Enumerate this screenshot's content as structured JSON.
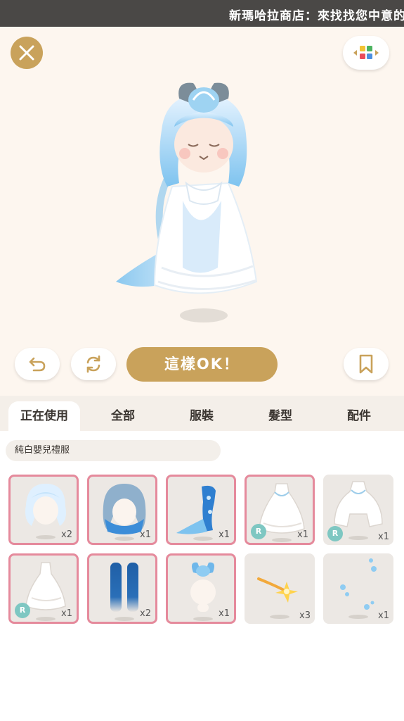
{
  "banner": {
    "text": "新瑪哈拉商店：來找找您中意的"
  },
  "toolbar": {
    "ok_label": "這樣OK！"
  },
  "tabs": [
    {
      "label": "正在使用",
      "active": true
    },
    {
      "label": "全部",
      "active": false
    },
    {
      "label": "服裝",
      "active": false
    },
    {
      "label": "髮型",
      "active": false
    },
    {
      "label": "配件",
      "active": false
    }
  ],
  "outfit": {
    "name": "純白嬰兒禮服"
  },
  "items": [
    {
      "name": "white-bob-hair",
      "qty": "x2",
      "equipped": true,
      "rarity": ""
    },
    {
      "name": "blue-gradient-hair",
      "qty": "x1",
      "equipped": true,
      "rarity": ""
    },
    {
      "name": "mermaid-tail-dress",
      "qty": "x1",
      "equipped": true,
      "rarity": ""
    },
    {
      "name": "white-lace-gown",
      "qty": "x1",
      "equipped": true,
      "rarity": "R"
    },
    {
      "name": "white-lace-gown-alt",
      "qty": "x1",
      "equipped": false,
      "rarity": "R"
    },
    {
      "name": "white-lace-dress",
      "qty": "x1",
      "equipped": true,
      "rarity": "R"
    },
    {
      "name": "blue-stockings",
      "qty": "x2",
      "equipped": true,
      "rarity": ""
    },
    {
      "name": "jellyfish-headpiece",
      "qty": "x1",
      "equipped": true,
      "rarity": ""
    },
    {
      "name": "sparkle-effect",
      "qty": "x3",
      "equipped": false,
      "rarity": ""
    },
    {
      "name": "bubble-effect",
      "qty": "x1",
      "equipped": false,
      "rarity": ""
    }
  ],
  "colors": {
    "gold": "#c9a25b",
    "equipped_border": "#e58a9c",
    "rarity_badge": "#7ec7c2"
  },
  "icons": [
    "close-icon",
    "palette-icon",
    "undo-icon",
    "refresh-icon",
    "bookmark-icon"
  ]
}
